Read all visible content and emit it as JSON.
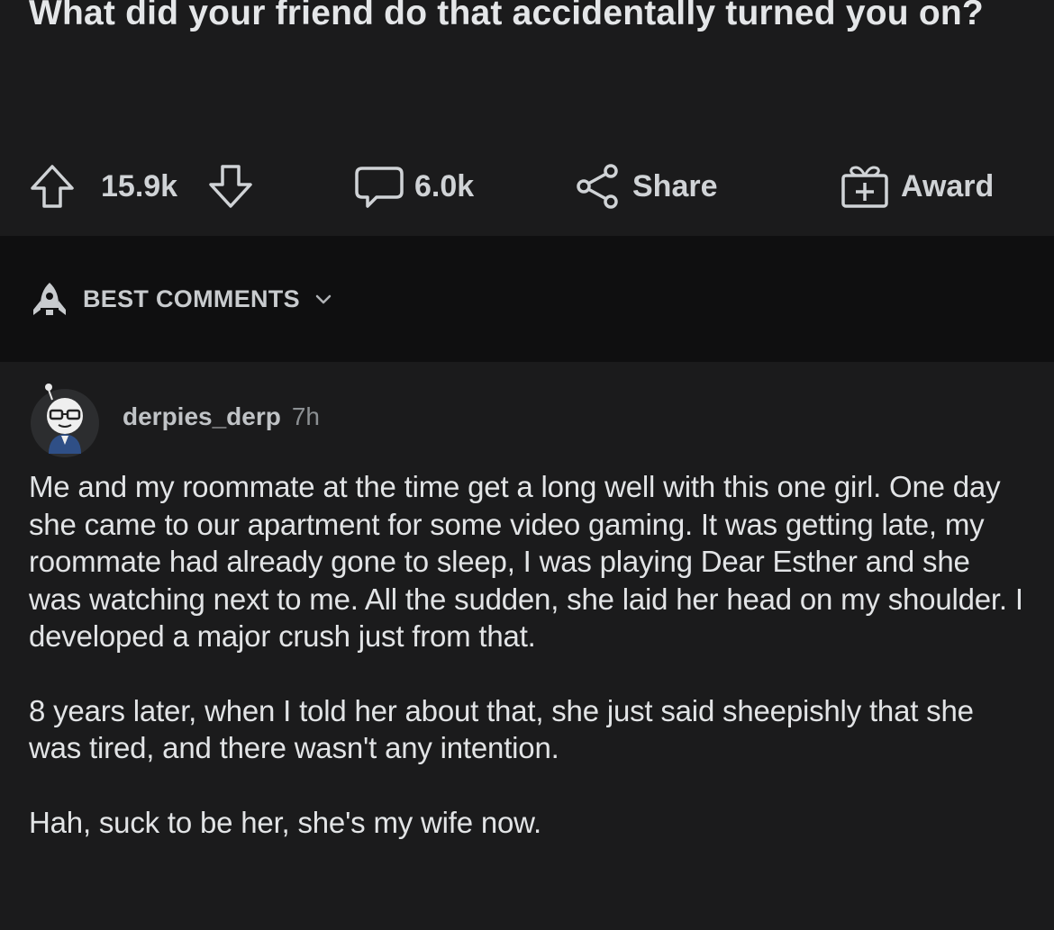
{
  "post": {
    "title": "What did your friend do that accidentally turned you on?",
    "votes": "15.9k",
    "comments": "6.0k",
    "share_label": "Share",
    "award_label": "Award"
  },
  "sort": {
    "label": "BEST COMMENTS"
  },
  "comment": {
    "username": "derpies_derp",
    "time": "7h",
    "paragraphs": [
      "Me and my roommate at the time get a long well with this one girl. One day she came to our apartment for some video gaming. It was getting late, my roommate had already gone to sleep, I was playing Dear Esther and she was watching next to me. All the sudden, she laid her head on my shoulder. I developed a major crush just from that.",
      "8 years later, when I told her about that, she just said sheepishly that she was tired, and there wasn't any intention.",
      "Hah, suck to be her, she's my wife now."
    ]
  },
  "icons": {
    "upvote": "arrow-up-icon",
    "downvote": "arrow-down-icon",
    "comments": "comment-bubble-icon",
    "share": "share-icon",
    "award": "gift-icon",
    "sort": "rocket-icon",
    "chevron": "chevron-down-icon"
  }
}
